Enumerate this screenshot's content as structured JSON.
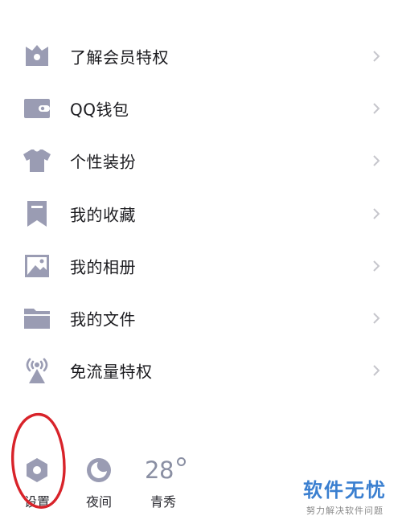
{
  "menu": {
    "items": [
      {
        "label": "了解会员特权",
        "icon": "crown-icon"
      },
      {
        "label": "QQ钱包",
        "icon": "wallet-icon"
      },
      {
        "label": "个性装扮",
        "icon": "tshirt-icon"
      },
      {
        "label": "我的收藏",
        "icon": "bookmark-icon"
      },
      {
        "label": "我的相册",
        "icon": "photo-icon"
      },
      {
        "label": "我的文件",
        "icon": "folder-icon"
      },
      {
        "label": "免流量特权",
        "icon": "antenna-icon"
      }
    ],
    "chevron_icon": "chevron-right-icon"
  },
  "bottom": {
    "settings_label": "设置",
    "night_label": "夜间",
    "weather": {
      "temperature": "28",
      "city": "青秀"
    }
  },
  "watermark": {
    "title": "软件无忧",
    "subtitle": "努力解决软件问题"
  },
  "colors": {
    "icon": "#9a9cb3",
    "text": "#1b1b1f",
    "chevron": "#c6c6cc",
    "annotation": "#d8232a",
    "watermark": "#3a7fd0"
  }
}
